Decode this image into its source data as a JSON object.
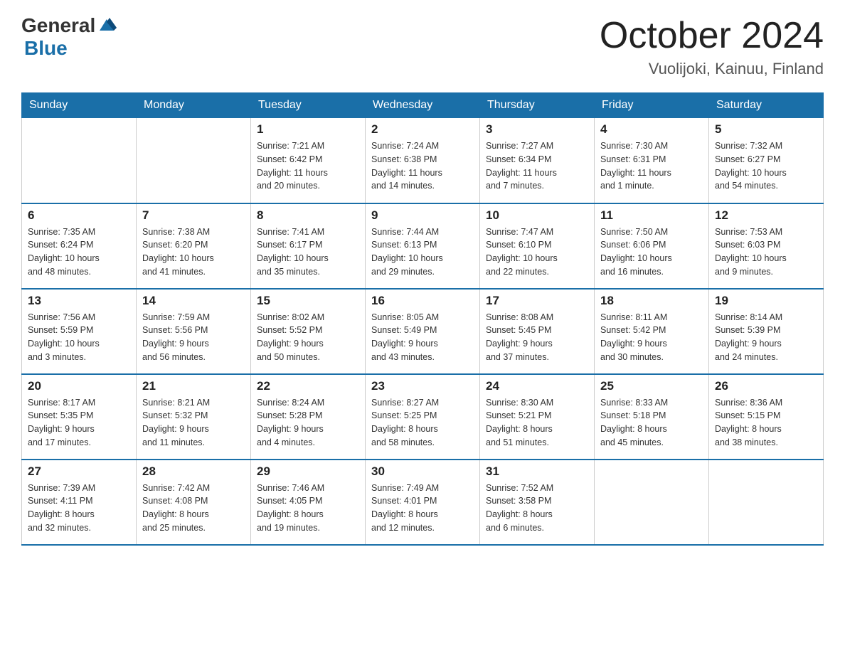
{
  "header": {
    "logo_general": "General",
    "logo_blue": "Blue",
    "month_title": "October 2024",
    "location": "Vuolijoki, Kainuu, Finland"
  },
  "weekdays": [
    "Sunday",
    "Monday",
    "Tuesday",
    "Wednesday",
    "Thursday",
    "Friday",
    "Saturday"
  ],
  "weeks": [
    [
      {
        "day": "",
        "info": ""
      },
      {
        "day": "",
        "info": ""
      },
      {
        "day": "1",
        "info": "Sunrise: 7:21 AM\nSunset: 6:42 PM\nDaylight: 11 hours\nand 20 minutes."
      },
      {
        "day": "2",
        "info": "Sunrise: 7:24 AM\nSunset: 6:38 PM\nDaylight: 11 hours\nand 14 minutes."
      },
      {
        "day": "3",
        "info": "Sunrise: 7:27 AM\nSunset: 6:34 PM\nDaylight: 11 hours\nand 7 minutes."
      },
      {
        "day": "4",
        "info": "Sunrise: 7:30 AM\nSunset: 6:31 PM\nDaylight: 11 hours\nand 1 minute."
      },
      {
        "day": "5",
        "info": "Sunrise: 7:32 AM\nSunset: 6:27 PM\nDaylight: 10 hours\nand 54 minutes."
      }
    ],
    [
      {
        "day": "6",
        "info": "Sunrise: 7:35 AM\nSunset: 6:24 PM\nDaylight: 10 hours\nand 48 minutes."
      },
      {
        "day": "7",
        "info": "Sunrise: 7:38 AM\nSunset: 6:20 PM\nDaylight: 10 hours\nand 41 minutes."
      },
      {
        "day": "8",
        "info": "Sunrise: 7:41 AM\nSunset: 6:17 PM\nDaylight: 10 hours\nand 35 minutes."
      },
      {
        "day": "9",
        "info": "Sunrise: 7:44 AM\nSunset: 6:13 PM\nDaylight: 10 hours\nand 29 minutes."
      },
      {
        "day": "10",
        "info": "Sunrise: 7:47 AM\nSunset: 6:10 PM\nDaylight: 10 hours\nand 22 minutes."
      },
      {
        "day": "11",
        "info": "Sunrise: 7:50 AM\nSunset: 6:06 PM\nDaylight: 10 hours\nand 16 minutes."
      },
      {
        "day": "12",
        "info": "Sunrise: 7:53 AM\nSunset: 6:03 PM\nDaylight: 10 hours\nand 9 minutes."
      }
    ],
    [
      {
        "day": "13",
        "info": "Sunrise: 7:56 AM\nSunset: 5:59 PM\nDaylight: 10 hours\nand 3 minutes."
      },
      {
        "day": "14",
        "info": "Sunrise: 7:59 AM\nSunset: 5:56 PM\nDaylight: 9 hours\nand 56 minutes."
      },
      {
        "day": "15",
        "info": "Sunrise: 8:02 AM\nSunset: 5:52 PM\nDaylight: 9 hours\nand 50 minutes."
      },
      {
        "day": "16",
        "info": "Sunrise: 8:05 AM\nSunset: 5:49 PM\nDaylight: 9 hours\nand 43 minutes."
      },
      {
        "day": "17",
        "info": "Sunrise: 8:08 AM\nSunset: 5:45 PM\nDaylight: 9 hours\nand 37 minutes."
      },
      {
        "day": "18",
        "info": "Sunrise: 8:11 AM\nSunset: 5:42 PM\nDaylight: 9 hours\nand 30 minutes."
      },
      {
        "day": "19",
        "info": "Sunrise: 8:14 AM\nSunset: 5:39 PM\nDaylight: 9 hours\nand 24 minutes."
      }
    ],
    [
      {
        "day": "20",
        "info": "Sunrise: 8:17 AM\nSunset: 5:35 PM\nDaylight: 9 hours\nand 17 minutes."
      },
      {
        "day": "21",
        "info": "Sunrise: 8:21 AM\nSunset: 5:32 PM\nDaylight: 9 hours\nand 11 minutes."
      },
      {
        "day": "22",
        "info": "Sunrise: 8:24 AM\nSunset: 5:28 PM\nDaylight: 9 hours\nand 4 minutes."
      },
      {
        "day": "23",
        "info": "Sunrise: 8:27 AM\nSunset: 5:25 PM\nDaylight: 8 hours\nand 58 minutes."
      },
      {
        "day": "24",
        "info": "Sunrise: 8:30 AM\nSunset: 5:21 PM\nDaylight: 8 hours\nand 51 minutes."
      },
      {
        "day": "25",
        "info": "Sunrise: 8:33 AM\nSunset: 5:18 PM\nDaylight: 8 hours\nand 45 minutes."
      },
      {
        "day": "26",
        "info": "Sunrise: 8:36 AM\nSunset: 5:15 PM\nDaylight: 8 hours\nand 38 minutes."
      }
    ],
    [
      {
        "day": "27",
        "info": "Sunrise: 7:39 AM\nSunset: 4:11 PM\nDaylight: 8 hours\nand 32 minutes."
      },
      {
        "day": "28",
        "info": "Sunrise: 7:42 AM\nSunset: 4:08 PM\nDaylight: 8 hours\nand 25 minutes."
      },
      {
        "day": "29",
        "info": "Sunrise: 7:46 AM\nSunset: 4:05 PM\nDaylight: 8 hours\nand 19 minutes."
      },
      {
        "day": "30",
        "info": "Sunrise: 7:49 AM\nSunset: 4:01 PM\nDaylight: 8 hours\nand 12 minutes."
      },
      {
        "day": "31",
        "info": "Sunrise: 7:52 AM\nSunset: 3:58 PM\nDaylight: 8 hours\nand 6 minutes."
      },
      {
        "day": "",
        "info": ""
      },
      {
        "day": "",
        "info": ""
      }
    ]
  ]
}
